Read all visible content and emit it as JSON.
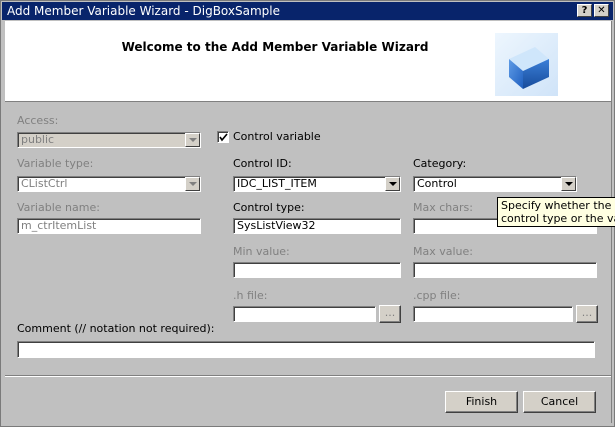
{
  "window": {
    "title": "Add Member Variable Wizard - DigBoxSample",
    "help_button": "?",
    "close_button": "✕"
  },
  "header": {
    "title": "Welcome to the Add Member Variable Wizard",
    "graphic_icon": "blue-cube-icon"
  },
  "access": {
    "label": "Access:",
    "value": "public"
  },
  "control_variable": {
    "label": "Control variable",
    "checked": true
  },
  "variable_type": {
    "label": "Variable type:",
    "value": "CListCtrl"
  },
  "control_id": {
    "label": "Control ID:",
    "value": "IDC_LIST_ITEM"
  },
  "category": {
    "label": "Category:",
    "value": "Control"
  },
  "variable_name": {
    "label": "Variable name:",
    "value": "m_ctrItemList"
  },
  "control_type": {
    "label": "Control type:",
    "value": "SysListView32"
  },
  "max_chars": {
    "label": "Max chars:",
    "value": ""
  },
  "min_value": {
    "label": "Min value:",
    "value": ""
  },
  "max_value": {
    "label": "Max value:",
    "value": ""
  },
  "h_file": {
    "label": ".h file:",
    "value": "",
    "browse": "..."
  },
  "cpp_file": {
    "label": ".cpp file:",
    "value": "",
    "browse": "..."
  },
  "comment": {
    "label": "Comment (// notation not required):",
    "value": ""
  },
  "tooltip": {
    "line1": "Specify whether the",
    "line2": "control type or the va"
  },
  "buttons": {
    "finish": "Finish",
    "cancel": "Cancel"
  }
}
